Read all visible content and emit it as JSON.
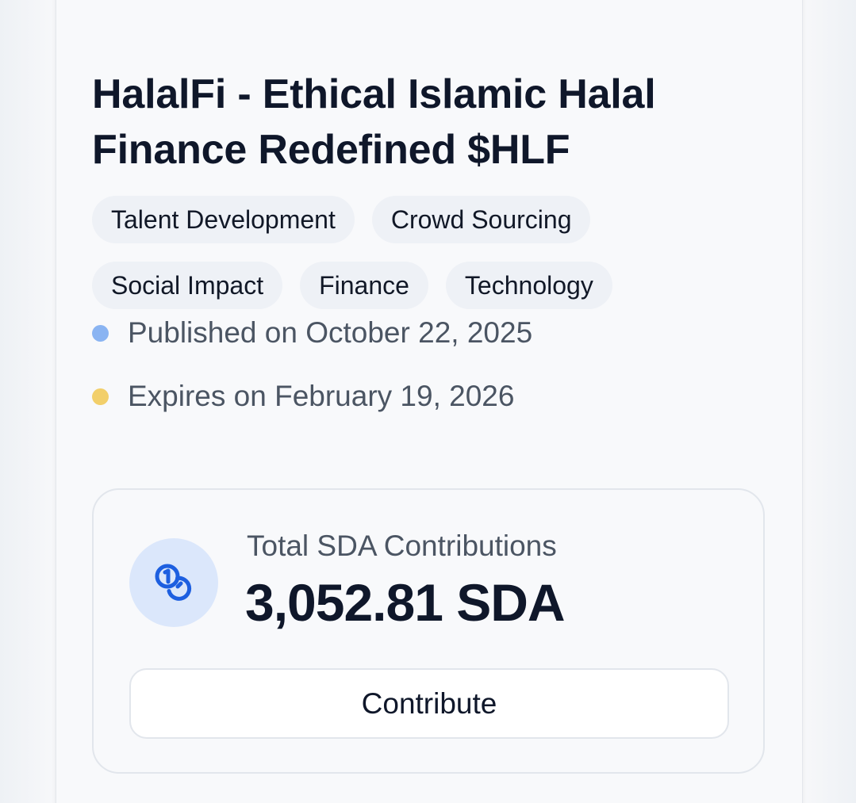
{
  "project": {
    "title": "HalalFi - Ethical Islamic Halal Finance Redefined $HLF",
    "tags": [
      "Talent Development",
      "Crowd Sourcing",
      "Social Impact",
      "Finance",
      "Technology"
    ]
  },
  "dates": {
    "published": "Published on October 22, 2025",
    "expires": "Expires on February 19, 2026"
  },
  "contributions": {
    "label": "Total SDA Contributions",
    "value": "3,052.81 SDA",
    "icon": "coins-icon",
    "button_label": "Contribute"
  },
  "colors": {
    "published_dot": "#8ab4f2",
    "expires_dot": "#f2cf6a",
    "icon_accent": "#1d5fe0"
  }
}
